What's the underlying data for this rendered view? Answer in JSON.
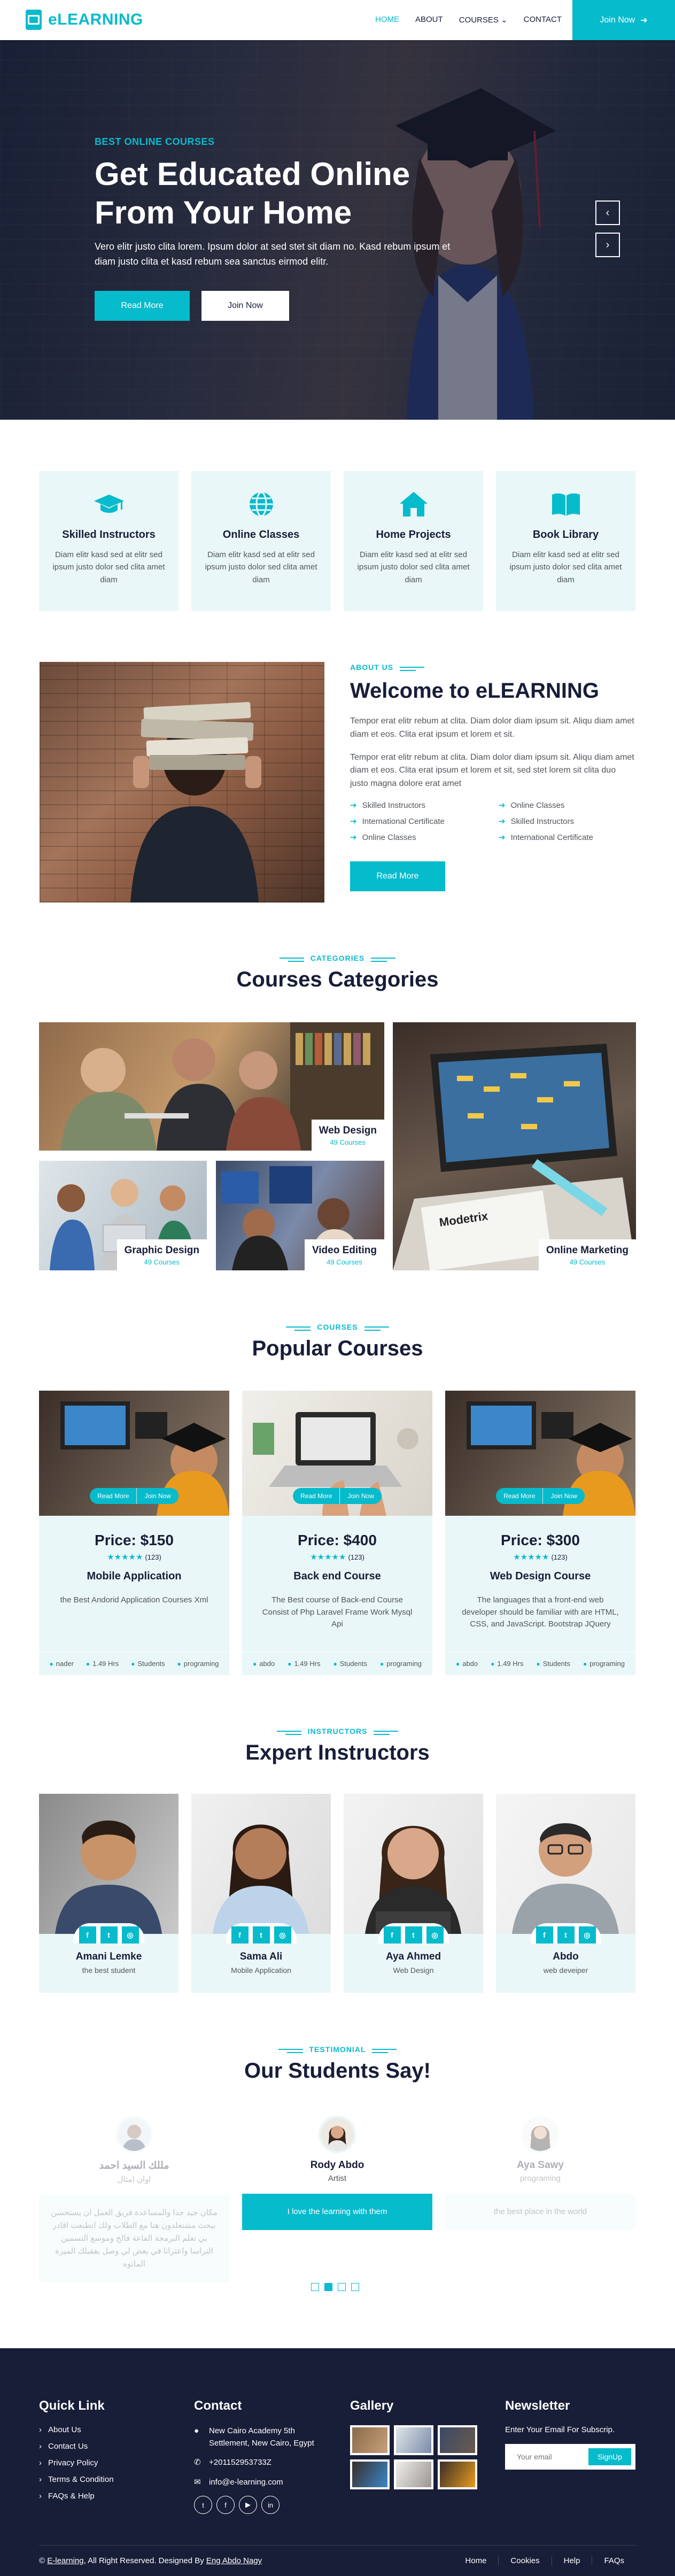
{
  "nav": {
    "brand": "eLEARNING",
    "links": [
      "HOME",
      "ABOUT",
      "COURSES",
      "CONTACT"
    ],
    "courses_caret": "⌄",
    "join_label": "Join Now",
    "join_arrow": "➔"
  },
  "hero": {
    "eyebrow": "BEST ONLINE COURSES",
    "title_line1": "Get Educated Online",
    "title_line2": "From Your Home",
    "text": "Vero elitr justo clita lorem. Ipsum dolor at sed stet sit diam no. Kasd rebum ipsum et diam justo clita et kasd rebum sea sanctus eirmod elitr.",
    "btn_primary": "Read More",
    "btn_secondary": "Join Now",
    "prev": "‹",
    "next": "›"
  },
  "services": [
    {
      "title": "Skilled Instructors",
      "text": "Diam elitr kasd sed at elitr sed ipsum justo dolor sed clita amet diam",
      "icon": "graduation-cap-icon"
    },
    {
      "title": "Online Classes",
      "text": "Diam elitr kasd sed at elitr sed ipsum justo dolor sed clita amet diam",
      "icon": "globe-icon"
    },
    {
      "title": "Home Projects",
      "text": "Diam elitr kasd sed at elitr sed ipsum justo dolor sed clita amet diam",
      "icon": "home-icon"
    },
    {
      "title": "Book Library",
      "text": "Diam elitr kasd sed at elitr sed ipsum justo dolor sed clita amet diam",
      "icon": "book-icon"
    }
  ],
  "about": {
    "eyebrow": "ABOUT US",
    "title": "Welcome to eLEARNING",
    "p1": "Tempor erat elitr rebum at clita. Diam dolor diam ipsum sit. Aliqu diam amet diam et eos. Clita erat ipsum et lorem et sit.",
    "p2": "Tempor erat elitr rebum at clita. Diam dolor diam ipsum sit. Aliqu diam amet diam et eos. Clita erat ipsum et lorem et sit, sed stet lorem sit clita duo justo magna dolore erat amet",
    "checklist": [
      "Skilled Instructors",
      "Online Classes",
      "International Certificate",
      "Skilled Instructors",
      "Online Classes",
      "International Certificate"
    ],
    "btn": "Read More"
  },
  "categories": {
    "eyebrow": "CATEGORIES",
    "title": "Courses Categories",
    "items": [
      {
        "name": "Web Design",
        "count": "49 Courses"
      },
      {
        "name": "Graphic Design",
        "count": "49 Courses"
      },
      {
        "name": "Video Editing",
        "count": "49 Courses"
      },
      {
        "name": "Online Marketing",
        "count": "49 Courses"
      }
    ]
  },
  "courses": {
    "eyebrow": "COURSES",
    "title": "Popular Courses",
    "read_more": "Read More",
    "join_now": "Join Now",
    "items": [
      {
        "price": "Price: $150",
        "stars": "★★★★★",
        "reviews": "(123)",
        "title": "Mobile Application",
        "desc": "the Best Andorid Application Courses Xml",
        "author": "nader",
        "hours": "1.49 Hrs",
        "students": "Students",
        "category": "programing"
      },
      {
        "price": "Price: $400",
        "stars": "★★★★★",
        "reviews": "(123)",
        "title": "Back end Course",
        "desc": "The Best course of Back-end Course Consist of Php Laravel Frame Work Mysql Api",
        "author": "abdo",
        "hours": "1.49 Hrs",
        "students": "Students",
        "category": "programing"
      },
      {
        "price": "Price: $300",
        "stars": "★★★★★",
        "reviews": "(123)",
        "title": "Web Design Course",
        "desc": "The languages that a front-end web developer should be familiar with are HTML, CSS, and JavaScript. Bootstrap JQuery",
        "author": "abdo",
        "hours": "1.49 Hrs",
        "students": "Students",
        "category": "programing"
      }
    ]
  },
  "instructors": {
    "eyebrow": "INSTRUCTORS",
    "title": "Expert Instructors",
    "social": [
      "f",
      "t",
      "◎"
    ],
    "items": [
      {
        "name": "Amani Lemke",
        "role": "the best student"
      },
      {
        "name": "Sama Ali",
        "role": "Mobile Application"
      },
      {
        "name": "Aya Ahmed",
        "role": "Web Design"
      },
      {
        "name": "Abdo",
        "role": "web deveiper"
      }
    ]
  },
  "testimonials": {
    "eyebrow": "TESTIMONIAL",
    "title": "Our Students Say!",
    "items": [
      {
        "name": "مللك السيد احمد",
        "prof": "اوان امثال",
        "quote": "مكان جيد جدا والمساعدة فريق العمل ان يستحسن ببحث مشتغلدون هنا مع الطلاب ولك انطبعت اقادر بي تعلم البرمجة الفاعة فالخ وموسع التسمين التراسا واعترانا في بعض لي وصل يفقيلك الميزة الماتوه"
      },
      {
        "name": "Rody Abdo",
        "prof": "Artist",
        "quote": "I love the learning with them"
      },
      {
        "name": "Aya Sawy",
        "prof": "programing",
        "quote": "the best place in the world"
      }
    ]
  },
  "footer": {
    "quick_title": "Quick Link",
    "quick_links": [
      "About Us",
      "Contact Us",
      "Privacy Policy",
      "Terms & Condition",
      "FAQs & Help"
    ],
    "contact_title": "Contact",
    "address": "New Cairo Academy 5th Settlement, New Cairo, Egypt",
    "phone": "+201152953733Z",
    "email": "info@e-learning.com",
    "social": [
      "t",
      "f",
      "▶",
      "in"
    ],
    "gallery_title": "Gallery",
    "newsletter_title": "Newsletter",
    "newsletter_text": "Enter Your Email For Subscrip.",
    "email_placeholder": "Your email",
    "signup": "SignUp",
    "copyright_prefix": "© ",
    "copyright_link": "E-learning",
    "copyright_mid": ", All Right Reserved. Designed By ",
    "designer": "Eng Abdo Nagy",
    "bottom_links": [
      "Home",
      "Cookies",
      "Help",
      "FAQs"
    ]
  },
  "colors": {
    "accent": "#06bbcc",
    "dark": "#181d38",
    "light": "#e9f7f8"
  }
}
